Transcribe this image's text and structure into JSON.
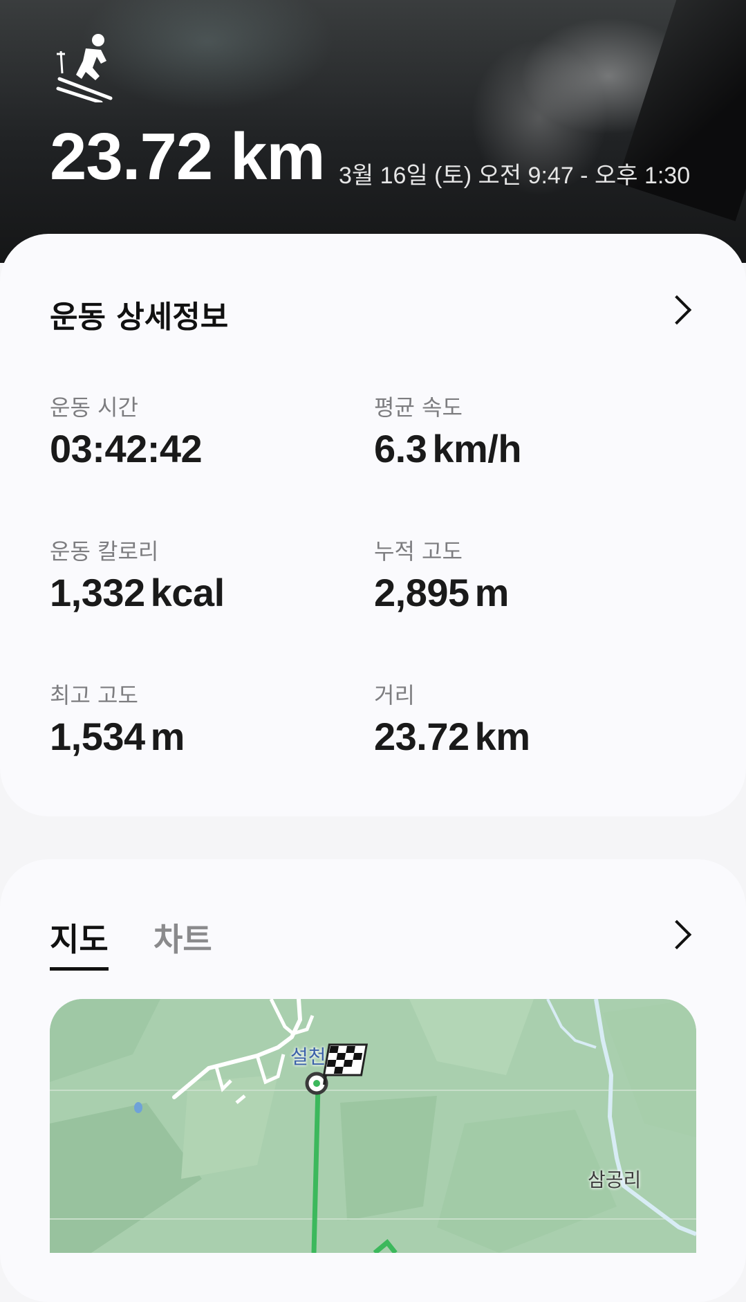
{
  "header": {
    "activity_icon": "skiing-icon",
    "distance": "23.72 km",
    "date_range": "3월 16일 (토) 오전 9:47 - 오후 1:30"
  },
  "details": {
    "title": "운동 상세정보",
    "stats": [
      {
        "label": "운동 시간",
        "value": "03:42:42",
        "unit": ""
      },
      {
        "label": "평균 속도",
        "value": "6.3",
        "unit": "km/h"
      },
      {
        "label": "운동 칼로리",
        "value": "1,332",
        "unit": "kcal"
      },
      {
        "label": "누적 고도",
        "value": "2,895",
        "unit": "m"
      },
      {
        "label": "최고 고도",
        "value": "1,534",
        "unit": "m"
      },
      {
        "label": "거리",
        "value": "23.72",
        "unit": "km"
      }
    ]
  },
  "map_section": {
    "tabs": [
      {
        "label": "지도",
        "active": true
      },
      {
        "label": "차트",
        "active": false
      }
    ],
    "places": [
      "설천",
      "삼공리"
    ],
    "colors": {
      "route": "#3cb85c",
      "map_bg": "#a9cfae"
    }
  }
}
